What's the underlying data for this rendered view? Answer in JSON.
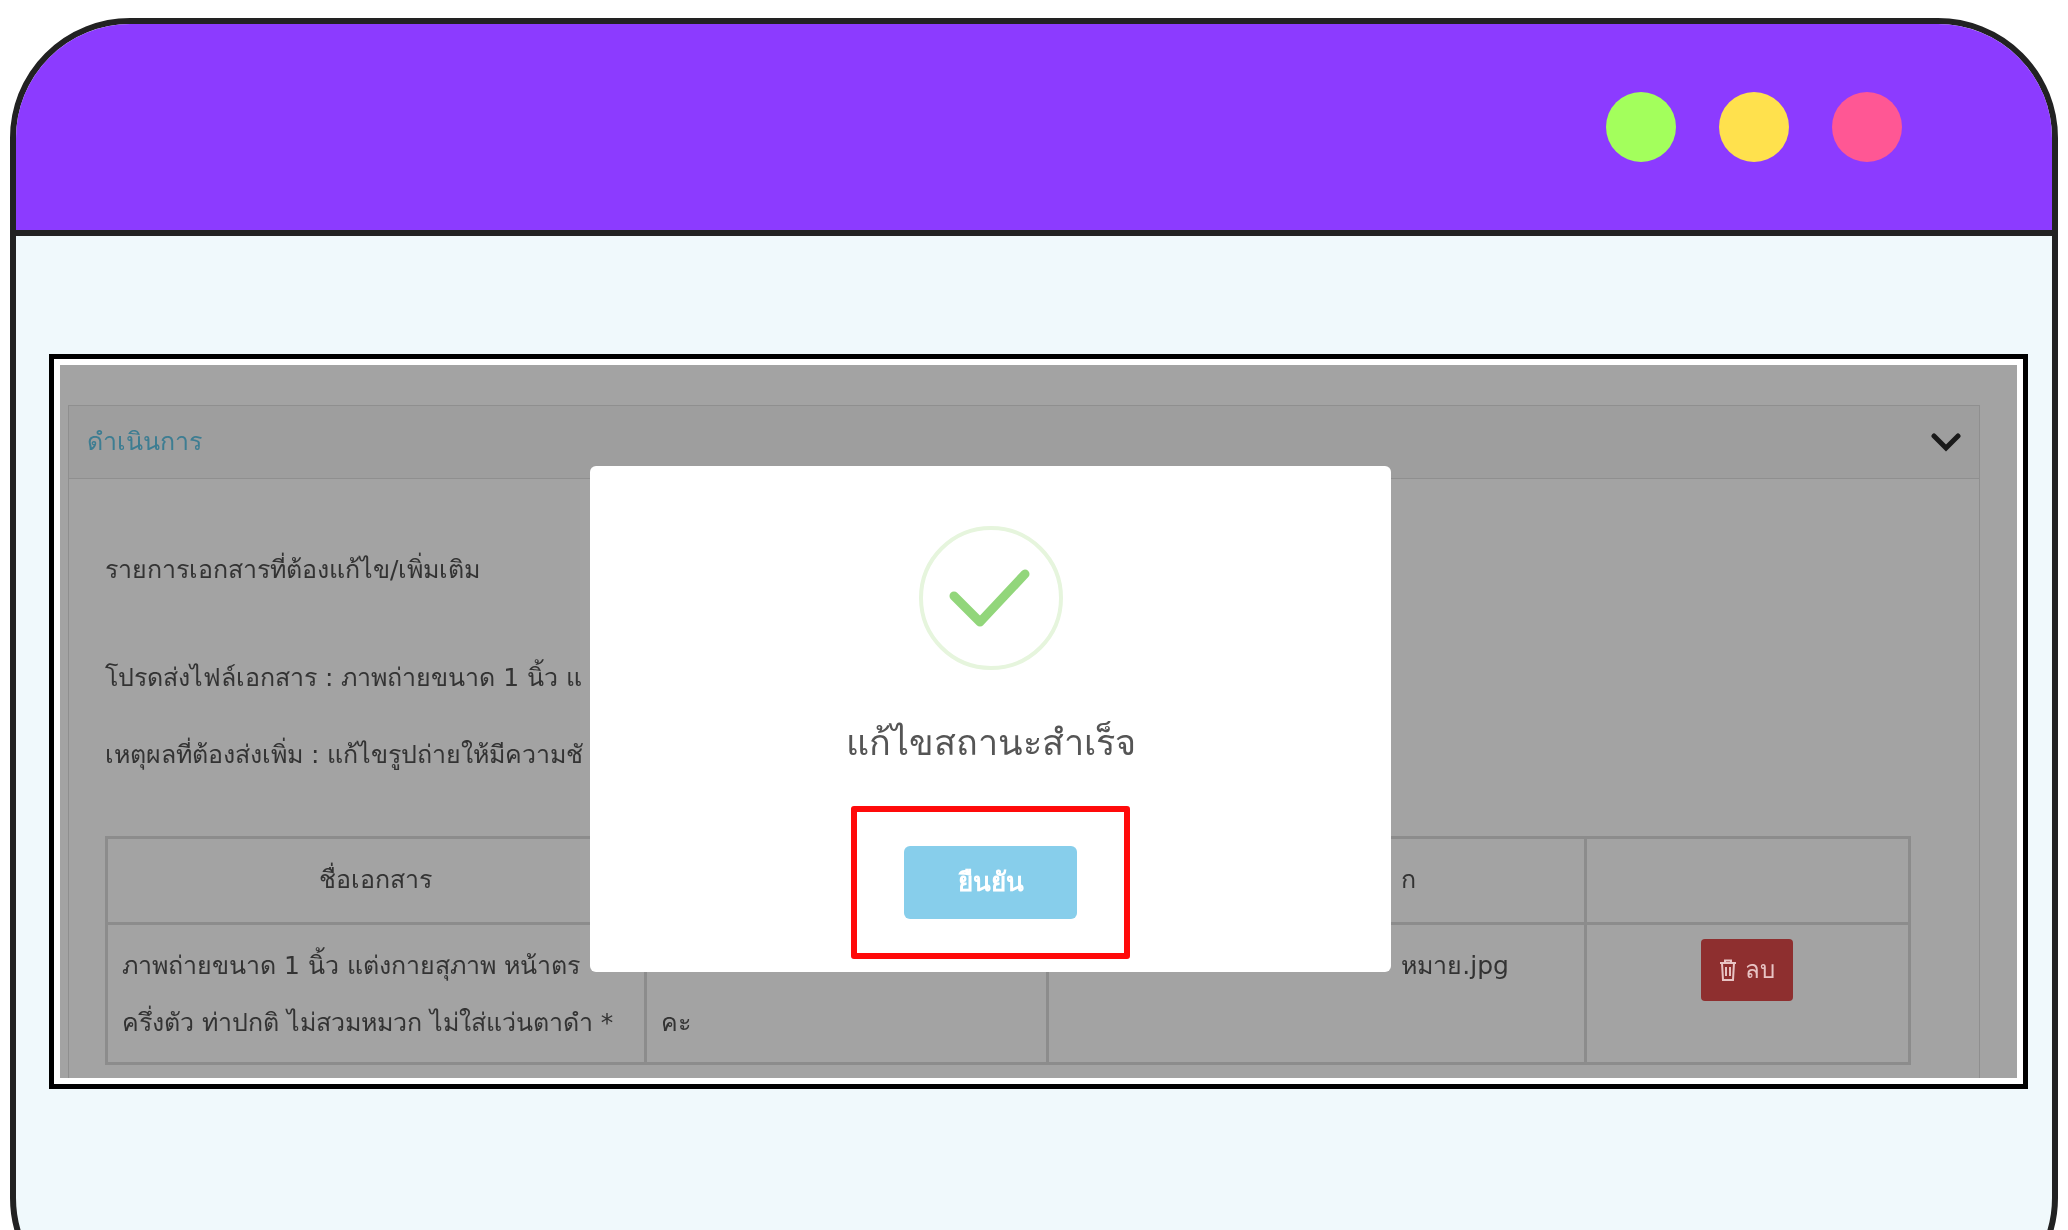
{
  "window": {
    "dots": [
      {
        "color": "#a3ff5c"
      },
      {
        "color": "#ffe14d"
      },
      {
        "color": "#ff5794"
      }
    ]
  },
  "panel": {
    "title": "ดำเนินการ",
    "heading": "รายการเอกสารที่ต้องแก้ไข/เพิ่มเติม",
    "lines": [
      "โปรดส่งไฟล์เอกสาร : ภาพถ่ายขนาด 1 นิ้ว แ",
      "เหตุผลที่ต้องส่งเพิ่ม : แก้ไขรูปถ่ายให้มีความชั"
    ],
    "table": {
      "columns": [
        {
          "label": "ชื่อเอกสาร"
        },
        {},
        {
          "label": "ก"
        },
        {}
      ],
      "rows": [
        [
          {
            "kind": "text",
            "lines": [
              "ภาพถ่ายขนาด 1 นิ้ว แต่งกายสุภาพ หน้าตร",
              "ครึ่งตัว ท่าปกติ ไม่สวมหมวก ไม่ใส่แว่นตาดำ *"
            ]
          },
          {
            "kind": "text",
            "lines": [
              "คะ"
            ]
          },
          {
            "kind": "text",
            "lines": [
              "หมาย.jpg"
            ]
          },
          {
            "kind": "delete",
            "label": "ลบ"
          }
        ]
      ]
    }
  },
  "dialog": {
    "message": "แก้ไขสถานะสำเร็จ",
    "button": "ยืนยัน",
    "button_highlighted": true
  }
}
